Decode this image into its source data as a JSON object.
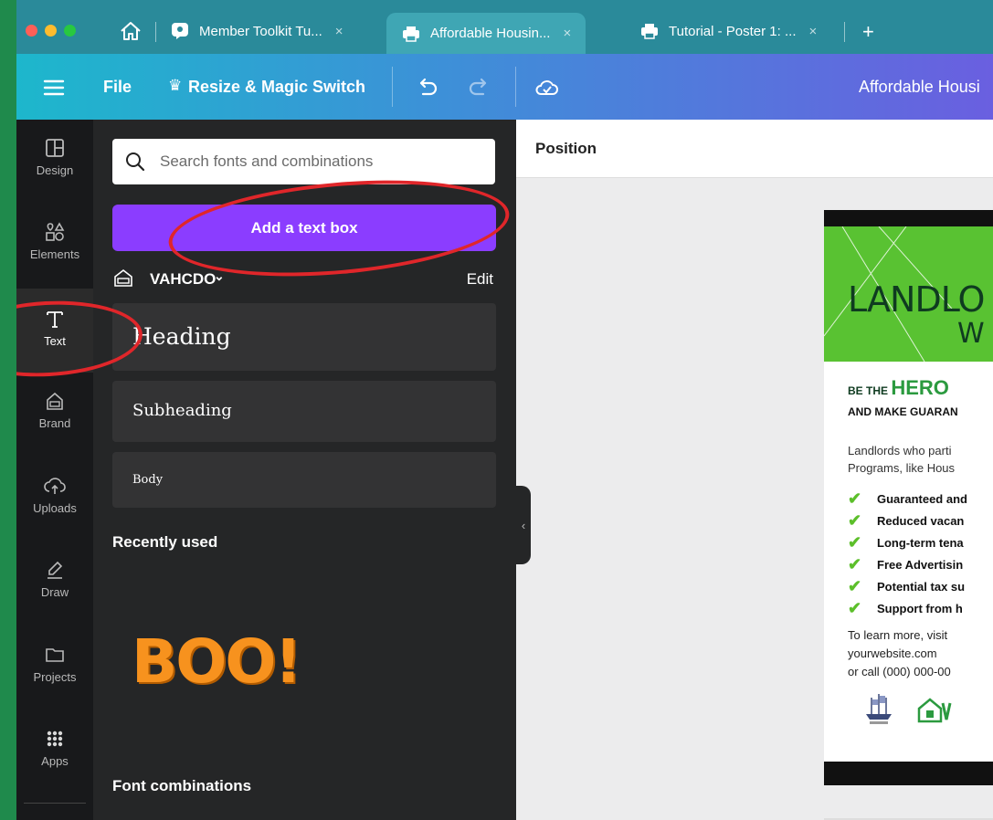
{
  "browser": {
    "tabs": [
      {
        "title": "Member Toolkit Tu...",
        "close": "×",
        "icon": "canva-chat-icon"
      },
      {
        "title": "Affordable Housin...",
        "close": "×",
        "icon": "printer-icon",
        "active": true
      },
      {
        "title": "Tutorial - Poster 1: ...",
        "close": "×",
        "icon": "printer-icon"
      }
    ],
    "new_tab": "+"
  },
  "toolbar": {
    "file": "File",
    "resize": "Resize & Magic Switch",
    "doc_title": "Affordable Housi"
  },
  "rail": {
    "items": [
      {
        "label": "Design",
        "icon": "layout-icon"
      },
      {
        "label": "Elements",
        "icon": "shapes-icon"
      },
      {
        "label": "Text",
        "icon": "text-icon"
      },
      {
        "label": "Brand",
        "icon": "brand-icon"
      },
      {
        "label": "Uploads",
        "icon": "upload-cloud-icon"
      },
      {
        "label": "Draw",
        "icon": "draw-icon"
      },
      {
        "label": "Projects",
        "icon": "folder-icon"
      },
      {
        "label": "Apps",
        "icon": "apps-grid-icon"
      }
    ]
  },
  "panel": {
    "search_placeholder": "Search fonts and combinations",
    "add_text_box": "Add a text box",
    "brand_kit": "VAHCDO",
    "edit": "Edit",
    "heading": "Heading",
    "subheading": "Subheading",
    "body": "Body",
    "recently_used": "Recently used",
    "recent_sample": "BOO!",
    "font_combinations": "Font combinations"
  },
  "canvas": {
    "position_label": "Position",
    "poster": {
      "headline1": "LANDLO",
      "headline2": "W",
      "hero_prefix": "BE THE",
      "hero_word": "HERO",
      "make_line": "AND MAKE GUARAN",
      "body_line1": "Landlords who parti",
      "body_line2": "Programs, like Hous",
      "bullets": [
        "Guaranteed and",
        "Reduced vacan",
        "Long-term tena",
        "Free Advertisin",
        "Potential tax su",
        "Support from h"
      ],
      "learn_line": "To learn more, visit",
      "website": "yourwebsite.com",
      "call_line": "or call (000) 000-00"
    }
  },
  "colors": {
    "accent_purple": "#8b3dff",
    "poster_green": "#59c232",
    "annotation_red": "#e0262a"
  }
}
